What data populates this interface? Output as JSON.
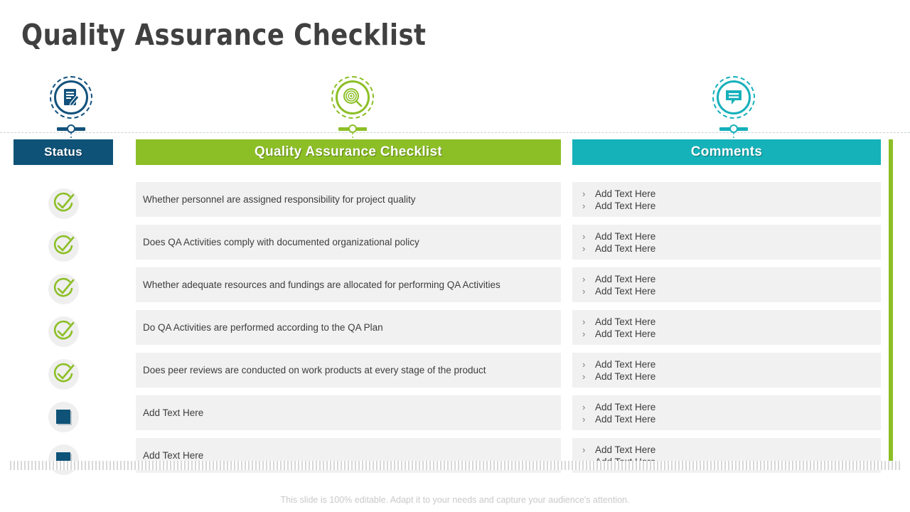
{
  "title": "Quality Assurance Checklist",
  "colors": {
    "navy": "#0f5277",
    "green": "#8cbf26",
    "teal": "#15b2b9",
    "row_bg": "#f1f1f1",
    "title_text": "#404040"
  },
  "icons": [
    {
      "name": "document-pen-icon",
      "color": "#13527c"
    },
    {
      "name": "target-magnifier-icon",
      "color": "#8cbf26"
    },
    {
      "name": "speech-bubble-icon",
      "color": "#16b0bb"
    }
  ],
  "table": {
    "headers": {
      "status": "Status",
      "checklist": "Quality Assurance Checklist",
      "comments": "Comments"
    },
    "rows": [
      {
        "status": "checked",
        "text": "Whether personnel are assigned responsibility for project quality",
        "comments": [
          "Add Text Here",
          "Add Text Here"
        ]
      },
      {
        "status": "checked",
        "text": "Does QA Activities comply with documented organizational policy",
        "comments": [
          "Add Text Here",
          "Add Text Here"
        ]
      },
      {
        "status": "checked",
        "text": "Whether adequate resources and fundings are allocated for performing QA Activities",
        "comments": [
          "Add Text Here",
          "Add Text Here"
        ]
      },
      {
        "status": "checked",
        "text": "Do QA Activities are performed according to the QA Plan",
        "comments": [
          "Add Text Here",
          "Add Text Here"
        ]
      },
      {
        "status": "checked",
        "text": "Does peer reviews are conducted on work products at every stage of the product",
        "comments": [
          "Add Text Here",
          "Add Text Here"
        ]
      },
      {
        "status": "square",
        "text": "Add Text Here",
        "comments": [
          "Add Text Here",
          "Add Text Here"
        ]
      },
      {
        "status": "square",
        "text": "Add Text Here",
        "comments": [
          "Add Text Here",
          "Add Text Here"
        ]
      }
    ],
    "bullet_marker": "›"
  },
  "footer": "This slide is 100% editable. Adapt it to your needs and capture your audience's attention."
}
